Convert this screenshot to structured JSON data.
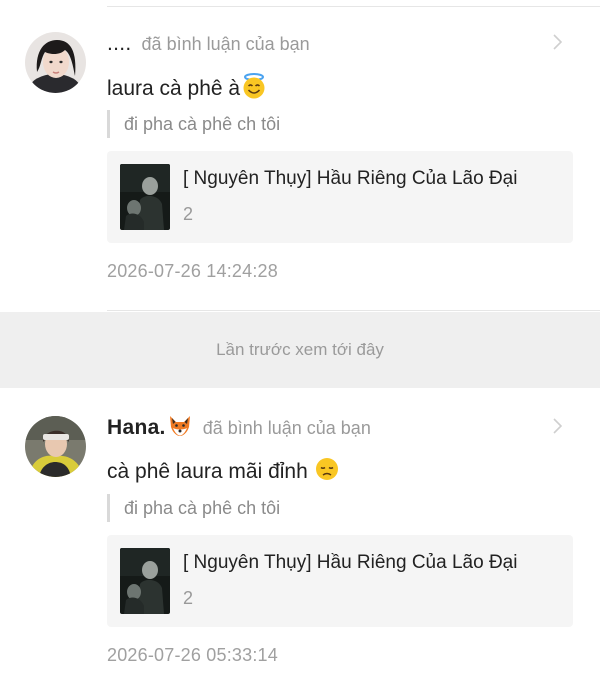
{
  "notifications": [
    {
      "username": "....",
      "action": "đã bình luận của bạn",
      "comment": "laura cà phê à",
      "comment_emoji": "smiling-face-with-halo",
      "quote": "đi pha cà phê ch tôi",
      "card": {
        "title": "[ Nguyên Thụy] Hầu Riêng Của Lão Đại",
        "sub": "2"
      },
      "timestamp": "2026-07-26 14:24:28"
    },
    {
      "username": "Hana.",
      "username_emoji": "fox-face",
      "action": "đã bình luận của bạn",
      "comment": "cà phê laura mãi đỉnh ",
      "comment_emoji": "disappointed-face",
      "quote": "đi pha cà phê ch tôi",
      "card": {
        "title": "[ Nguyên Thụy] Hầu Riêng Của Lão Đại",
        "sub": "2"
      },
      "timestamp": "2026-07-26 05:33:14"
    }
  ],
  "last_seen_divider": "Lần trước xem tới đây",
  "colors": {
    "muted": "#9a9a9a",
    "text": "#222222",
    "card_bg": "#f5f5f5",
    "divider_bg": "#efefef"
  }
}
